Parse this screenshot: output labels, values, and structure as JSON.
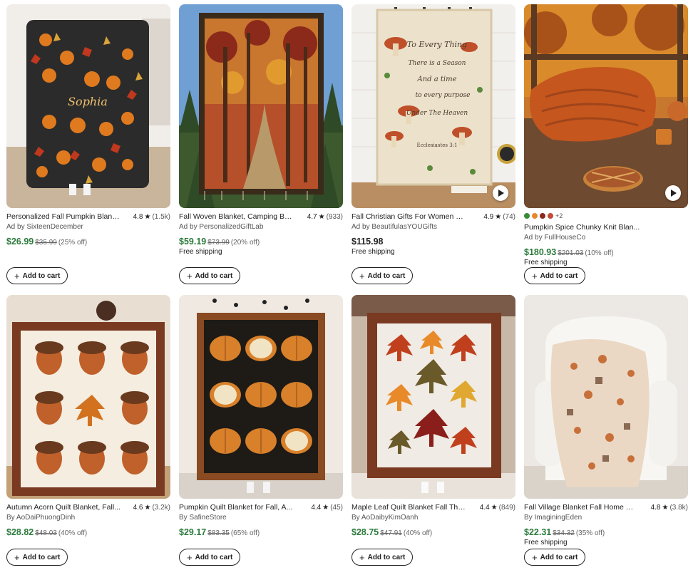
{
  "products": [
    {
      "title": "Personalized Fall Pumpkin Blanket...",
      "rating": "4.8",
      "reviews": "(1.5k)",
      "seller": "Ad by SixteenDecember",
      "price": "$26.99",
      "orig": "$35.99",
      "discount": "(25% off)",
      "shipping": "",
      "add_label": "Add to cart",
      "star": "★",
      "image": "pumpkin-name-blanket"
    },
    {
      "title": "Fall Woven Blanket, Camping Bla...",
      "rating": "4.7",
      "reviews": "(933)",
      "seller": "Ad by PersonalizedGiftLab",
      "price": "$59.19",
      "orig": "$73.99",
      "discount": "(20% off)",
      "shipping": "Free shipping",
      "add_label": "Add to cart",
      "star": "★",
      "image": "forest-woven-blanket"
    },
    {
      "title": "Fall Christian Gifts For Women - ...",
      "rating": "4.9",
      "reviews": "(74)",
      "seller": "Ad by BeautifulasYOUGifts",
      "price": "$115.98",
      "orig": "",
      "discount": "",
      "shipping": "Free shipping",
      "add_label": "Add to cart",
      "star": "★",
      "image": "mushroom-verse-blanket",
      "image_text": {
        "line1": "To Every Thing",
        "line2": "There is a Season",
        "line3": "And a time",
        "line4": "to every purpose",
        "line5": "Under The Heaven",
        "line6": "Ecclesiastes 3:1"
      }
    },
    {
      "title": "Pumpkin Spice Chunky Knit Blan...",
      "rating": "",
      "reviews": "",
      "seller": "Ad by FullHouseCo",
      "price": "$180.93",
      "orig": "$201.03",
      "discount": "(10% off)",
      "shipping": "Free shipping",
      "add_label": "Add to cart",
      "star": "",
      "image": "chunky-knit-blanket",
      "swatch_colors": [
        "#3a8a3a",
        "#e8862e",
        "#8a2a1e",
        "#c44a3a"
      ],
      "swatch_more": "+2"
    },
    {
      "title": "Autumn Acorn Quilt Blanket, Fall...",
      "rating": "4.6",
      "reviews": "(3.2k)",
      "seller": "By AoDaiPhuongDinh",
      "price": "$28.82",
      "orig": "$48.03",
      "discount": "(40% off)",
      "shipping": "",
      "add_label": "Add to cart",
      "star": "★",
      "image": "acorn-quilt"
    },
    {
      "title": "Pumpkin Quilt Blanket for Fall, A...",
      "rating": "4.4",
      "reviews": "(45)",
      "seller": "By SafineStore",
      "price": "$29.17",
      "orig": "$83.35",
      "discount": "(65% off)",
      "shipping": "",
      "add_label": "Add to cart",
      "star": "★",
      "image": "pumpkin-quilt"
    },
    {
      "title": "Maple Leaf Quilt Blanket Fall The...",
      "rating": "4.4",
      "reviews": "(849)",
      "seller": "By AoDaibyKimOanh",
      "price": "$28.75",
      "orig": "$47.91",
      "discount": "(40% off)",
      "shipping": "",
      "add_label": "Add to cart",
      "star": "★",
      "image": "maple-leaf-quilt"
    },
    {
      "title": "Fall Village Blanket Fall Home De...",
      "rating": "4.8",
      "reviews": "(3.8k)",
      "seller": "By ImaginingEden",
      "price": "$22.31",
      "orig": "$34.32",
      "discount": "(35% off)",
      "shipping": "Free shipping",
      "add_label": "Add to cart",
      "star": "★",
      "image": "village-blanket-chair"
    }
  ],
  "image_labels": {
    "personalized_name": "Sophia"
  },
  "colors": {
    "sale_green": "#2b7a3b",
    "text": "#222222"
  }
}
